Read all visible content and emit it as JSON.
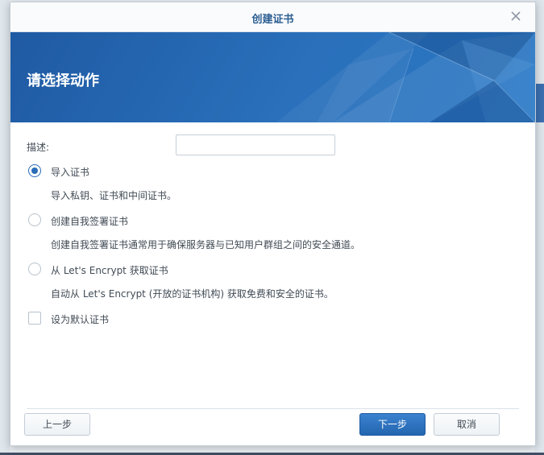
{
  "dialog": {
    "title": "创建证书",
    "banner_title": "请选择动作"
  },
  "form": {
    "description_label": "描述:",
    "description_value": "",
    "options": [
      {
        "label": "导入证书",
        "desc": "导入私钥、证书和中间证书。",
        "checked": true
      },
      {
        "label": "创建自我签署证书",
        "desc": "创建自我签署证书通常用于确保服务器与已知用户群组之间的安全通道。",
        "checked": false
      },
      {
        "label": "从 Let's Encrypt 获取证书",
        "desc": "自动从 Let's Encrypt (开放的证书机构) 获取免费和安全的证书。",
        "checked": false
      }
    ],
    "default_cert_label": "设为默认证书",
    "default_cert_checked": false
  },
  "buttons": {
    "prev": "上一步",
    "next": "下一步",
    "cancel": "取消"
  },
  "icons": {
    "close": "close-icon",
    "radio": "radio-icon",
    "checkbox": "checkbox-icon"
  },
  "colors": {
    "accent": "#2a6cb6",
    "banner": "#2a70bb",
    "title": "#2c5e92"
  }
}
